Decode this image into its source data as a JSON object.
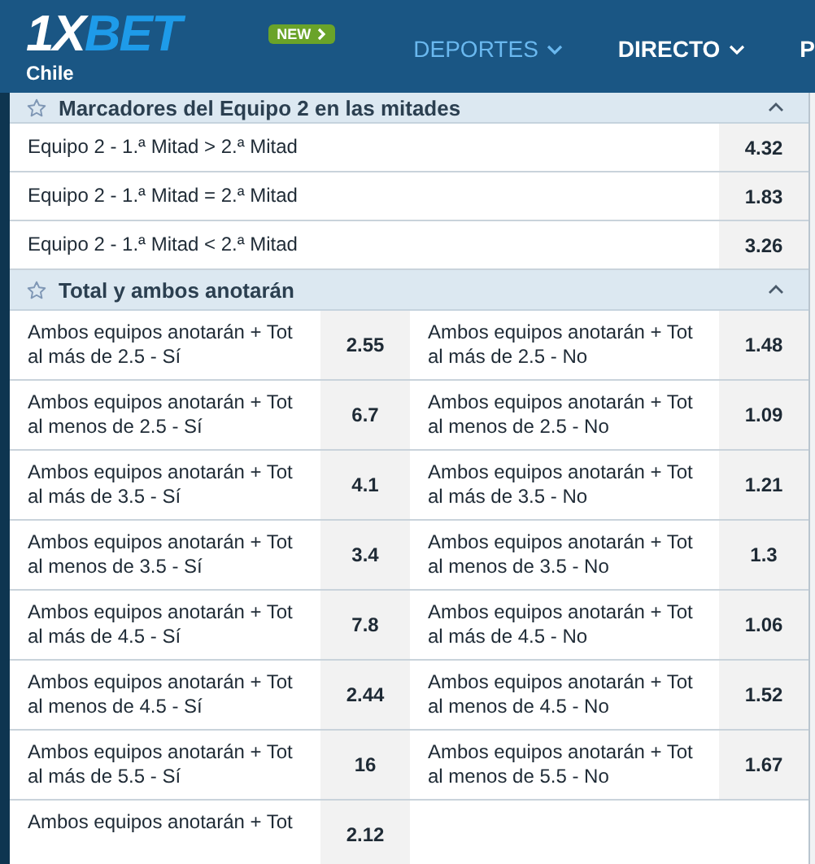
{
  "header": {
    "logo": [
      "1X",
      "BET"
    ],
    "region": "Chile",
    "badge": "NEW",
    "nav": [
      {
        "label": "DEPORTES",
        "selected": true,
        "dropdown": true
      },
      {
        "label": "DIRECTO",
        "selected": false,
        "dropdown": true
      },
      {
        "label": "P",
        "selected": false,
        "dropdown": false
      }
    ]
  },
  "sections": [
    {
      "title": "Marcadores del Equipo 2 en las mitades",
      "expanded": true,
      "kind": "single",
      "markets": [
        {
          "label": "Equipo 2 - 1.ª Mitad > 2.ª Mitad",
          "odds": "4.32"
        },
        {
          "label": "Equipo 2 - 1.ª Mitad = 2.ª Mitad",
          "odds": "1.83"
        },
        {
          "label": "Equipo 2 - 1.ª Mitad < 2.ª Mitad",
          "odds": "3.26"
        }
      ]
    },
    {
      "title": "Total y ambos anotarán",
      "expanded": true,
      "kind": "pairs",
      "markets": [
        {
          "label": "Ambos equipos anotarán + Tot al más de 2.5 - Sí",
          "odds": "2.55"
        },
        {
          "label": "Ambos equipos anotarán + Tot al más de 2.5 - No",
          "odds": "1.48"
        },
        {
          "label": "Ambos equipos anotarán + Tot al menos de 2.5 - Sí",
          "odds": "6.7"
        },
        {
          "label": "Ambos equipos anotarán + Tot al menos de 2.5 - No",
          "odds": "1.09"
        },
        {
          "label": "Ambos equipos anotarán + Tot al más de 3.5 - Sí",
          "odds": "4.1"
        },
        {
          "label": "Ambos equipos anotarán + Tot al más de 3.5 - No",
          "odds": "1.21"
        },
        {
          "label": "Ambos equipos anotarán + Tot al menos de 3.5 - Sí",
          "odds": "3.4"
        },
        {
          "label": "Ambos equipos anotarán + Tot al menos de 3.5 - No",
          "odds": "1.3"
        },
        {
          "label": "Ambos equipos anotarán + Tot al más de 4.5 - Sí",
          "odds": "7.8"
        },
        {
          "label": "Ambos equipos anotarán + Tot al más de 4.5 - No",
          "odds": "1.06"
        },
        {
          "label": "Ambos equipos anotarán + Tot al menos de 4.5 - Sí",
          "odds": "2.44"
        },
        {
          "label": "Ambos equipos anotarán + Tot al menos de 4.5 - No",
          "odds": "1.52"
        },
        {
          "label": "Ambos equipos anotarán + Tot al más de 5.5 - Sí",
          "odds": "16"
        },
        {
          "label": "Ambos equipos anotarán + Tot al menos de 5.5 - No",
          "odds": "1.67"
        },
        {
          "label": "Ambos equipos anotarán + Tot",
          "odds": "2.12"
        }
      ]
    }
  ]
}
